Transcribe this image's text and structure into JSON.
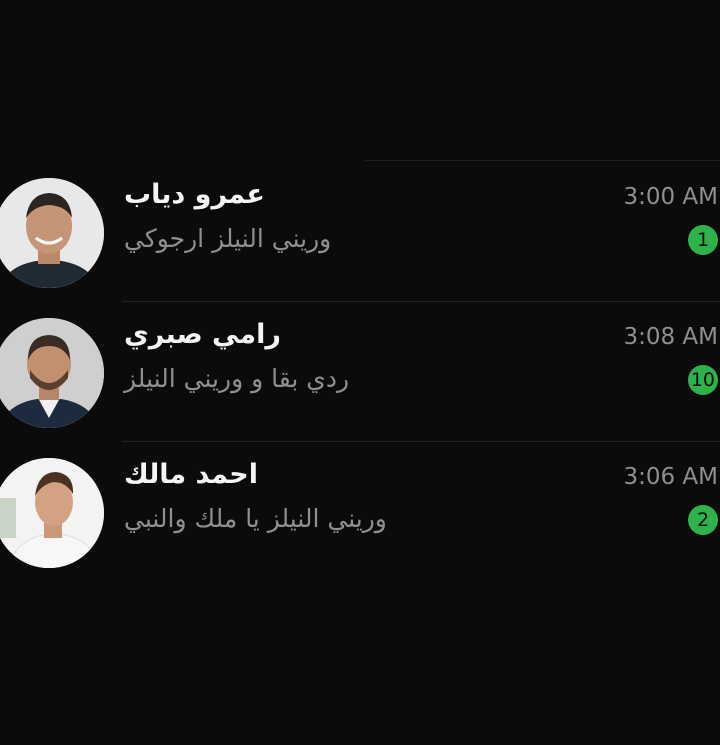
{
  "chats": [
    {
      "name": "عمرو دياب",
      "preview": "وريني النيلز ارجوكي",
      "time": "3:00 AM",
      "unread": "1",
      "avatar_icon": "person-avatar-icon"
    },
    {
      "name": "رامي صبري",
      "preview": "ردي بقا و وريني النيلز",
      "time": "3:08 AM",
      "unread": "10",
      "avatar_icon": "person-avatar-icon"
    },
    {
      "name": "احمد مالك",
      "preview": "وريني النيلز يا ملك والنبي",
      "time": "3:06 AM",
      "unread": "2",
      "avatar_icon": "person-avatar-icon"
    }
  ],
  "colors": {
    "background": "#0b0b0b",
    "badge": "#2db34a",
    "secondary_text": "#8e8e93"
  }
}
